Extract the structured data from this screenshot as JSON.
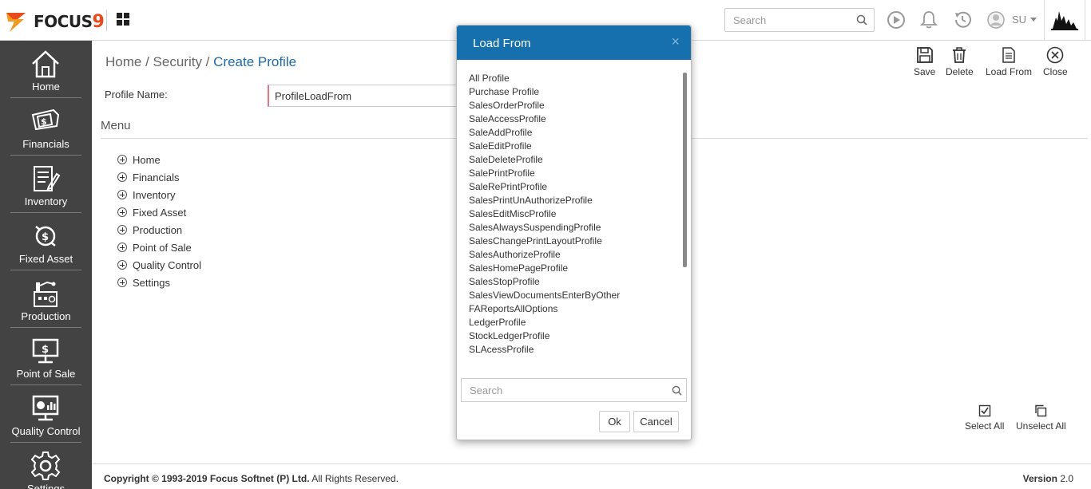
{
  "app": {
    "logo_text": "FOCUS",
    "logo_digit": "9",
    "search_placeholder": "Search",
    "user_initials": "SU"
  },
  "sidebar": {
    "items": [
      {
        "label": "Home",
        "icon": "home-icon"
      },
      {
        "label": "Financials",
        "icon": "financials-icon"
      },
      {
        "label": "Inventory",
        "icon": "inventory-icon"
      },
      {
        "label": "Fixed Asset",
        "icon": "fixed-asset-icon"
      },
      {
        "label": "Production",
        "icon": "production-icon"
      },
      {
        "label": "Point of Sale",
        "icon": "point-of-sale-icon"
      },
      {
        "label": "Quality Control",
        "icon": "quality-control-icon"
      },
      {
        "label": "Settings",
        "icon": "gear-icon"
      }
    ]
  },
  "breadcrumb": {
    "home": "Home /",
    "security": "Security /",
    "current": "Create Profile"
  },
  "toolbar": {
    "save": "Save",
    "delete": "Delete",
    "load_from": "Load From",
    "close": "Close"
  },
  "form": {
    "profile_name_label": "Profile Name:",
    "profile_name_value": "ProfileLoadFrom"
  },
  "menu": {
    "title": "Menu",
    "items": [
      "Home",
      "Financials",
      "Inventory",
      "Fixed Asset",
      "Production",
      "Point of Sale",
      "Quality Control",
      "Settings"
    ]
  },
  "selection": {
    "select_all": "Select All",
    "unselect_all": "Unselect All"
  },
  "footer": {
    "copyright_prefix": "Copyright © 1993-2019 Focus Softnet (P) Ltd.",
    "copyright_suffix": " All Rights Reserved.",
    "version_label": "Version",
    "version_value": "2.0"
  },
  "modal": {
    "title": "Load From",
    "close_glyph": "×",
    "profiles": [
      "All Profile",
      "Purchase Profile",
      "SalesOrderProfile",
      "SaleAccessProfile",
      "SaleAddProfile",
      "SaleEditProfile",
      "SaleDeleteProfile",
      "SalePrintProfile",
      "SaleRePrintProfile",
      "SalesPrintUnAuthorizeProfile",
      "SalesEditMiscProfile",
      "SalesAlwaysSuspendingProfile",
      "SalesChangePrintLayoutProfile",
      "SalesAuthorizeProfile",
      "SalesHomePageProfile",
      "SalesStopProfile",
      "SalesViewDocumentsEnterByOther",
      "FAReportsAllOptions",
      "LedgerProfile",
      "StockLedgerProfile",
      "SLAcessProfile"
    ],
    "search_placeholder": "Search",
    "ok_label": "Ok",
    "cancel_label": "Cancel"
  },
  "colors": {
    "sidebar_bg": "#434343",
    "modal_header": "#1570ad",
    "breadcrumb_current": "#1c6aa6",
    "logo_accent": "#e8491d"
  }
}
